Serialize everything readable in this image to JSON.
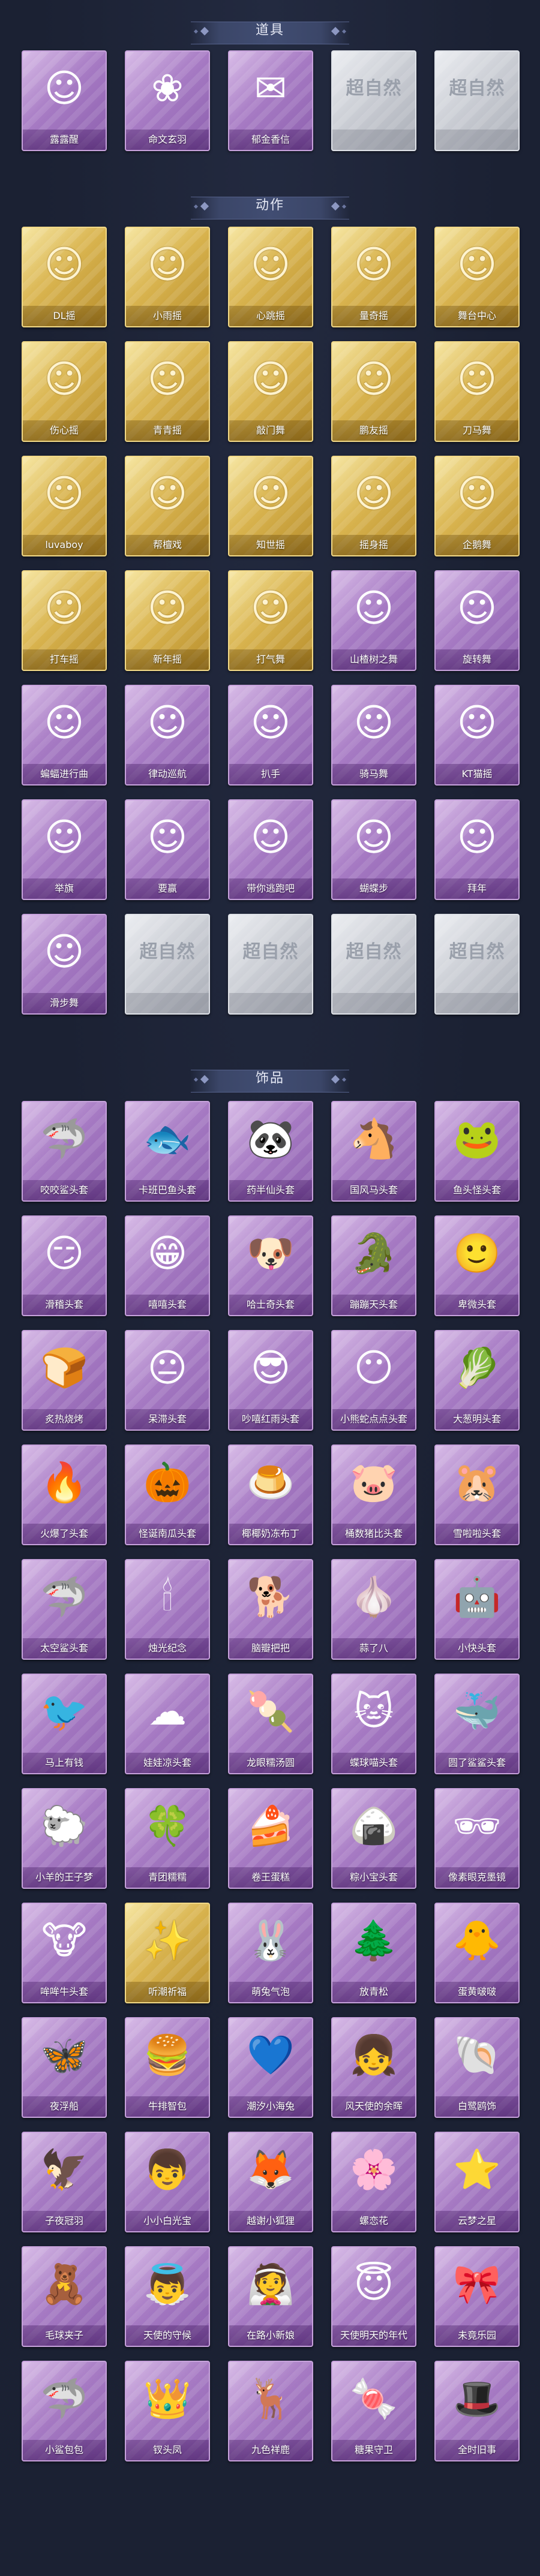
{
  "sections": [
    {
      "title": "道具",
      "items": [
        {
          "label": "露露醒",
          "tier": "purple",
          "icon": "☺"
        },
        {
          "label": "命文玄羽",
          "tier": "purple",
          "icon": "❀"
        },
        {
          "label": "郁金香信",
          "tier": "purple",
          "icon": "✉"
        },
        {
          "label": "",
          "tier": "silver",
          "icon": "超自然"
        },
        {
          "label": "",
          "tier": "silver",
          "icon": "超自然"
        }
      ]
    },
    {
      "title": "动作",
      "items": [
        {
          "label": "DL摇",
          "tier": "gold",
          "icon": "☺"
        },
        {
          "label": "小雨摇",
          "tier": "gold",
          "icon": "☺"
        },
        {
          "label": "心跳摇",
          "tier": "gold",
          "icon": "☺"
        },
        {
          "label": "量奇摇",
          "tier": "gold",
          "icon": "☺"
        },
        {
          "label": "舞台中心",
          "tier": "gold",
          "icon": "☺"
        },
        {
          "label": "伤心摇",
          "tier": "gold",
          "icon": "☺"
        },
        {
          "label": "青青摇",
          "tier": "gold",
          "icon": "☺"
        },
        {
          "label": "敲门舞",
          "tier": "gold",
          "icon": "☺"
        },
        {
          "label": "鹏友摇",
          "tier": "gold",
          "icon": "☺"
        },
        {
          "label": "刀马舞",
          "tier": "gold",
          "icon": "☺"
        },
        {
          "label": "luvaboy",
          "tier": "gold",
          "icon": "☺"
        },
        {
          "label": "帮檀戏",
          "tier": "gold",
          "icon": "☺"
        },
        {
          "label": "知世摇",
          "tier": "gold",
          "icon": "☺"
        },
        {
          "label": "摇身摇",
          "tier": "gold",
          "icon": "☺"
        },
        {
          "label": "企鹅舞",
          "tier": "gold",
          "icon": "☺"
        },
        {
          "label": "打车摇",
          "tier": "gold",
          "icon": "☺"
        },
        {
          "label": "新年摇",
          "tier": "gold",
          "icon": "☺"
        },
        {
          "label": "打气舞",
          "tier": "gold",
          "icon": "☺"
        },
        {
          "label": "山楂树之舞",
          "tier": "purple",
          "icon": "☺"
        },
        {
          "label": "旋转舞",
          "tier": "purple",
          "icon": "☺"
        },
        {
          "label": "蝙蝠进行曲",
          "tier": "purple",
          "icon": "☺"
        },
        {
          "label": "律动巡航",
          "tier": "purple",
          "icon": "☺"
        },
        {
          "label": "扒手",
          "tier": "purple",
          "icon": "☺"
        },
        {
          "label": "骑马舞",
          "tier": "purple",
          "icon": "☺"
        },
        {
          "label": "KT猫摇",
          "tier": "purple",
          "icon": "☺"
        },
        {
          "label": "举旗",
          "tier": "purple",
          "icon": "☺"
        },
        {
          "label": "要赢",
          "tier": "purple",
          "icon": "☺"
        },
        {
          "label": "带你逃跑吧",
          "tier": "purple",
          "icon": "☺"
        },
        {
          "label": "蝴蝶步",
          "tier": "purple",
          "icon": "☺"
        },
        {
          "label": "拜年",
          "tier": "purple",
          "icon": "☺"
        },
        {
          "label": "滑步舞",
          "tier": "purple",
          "icon": "☺"
        },
        {
          "label": "",
          "tier": "silver",
          "icon": "超自然"
        },
        {
          "label": "",
          "tier": "silver",
          "icon": "超自然"
        },
        {
          "label": "",
          "tier": "silver",
          "icon": "超自然"
        },
        {
          "label": "",
          "tier": "silver",
          "icon": "超自然"
        }
      ]
    },
    {
      "title": "饰品",
      "items": [
        {
          "label": "咬咬鲨头套",
          "tier": "purple",
          "icon": "🦈"
        },
        {
          "label": "卡班巴鱼头套",
          "tier": "purple",
          "icon": "🐟"
        },
        {
          "label": "药半仙头套",
          "tier": "purple",
          "icon": "🐼"
        },
        {
          "label": "国风马头套",
          "tier": "purple",
          "icon": "🐴"
        },
        {
          "label": "鱼头怪头套",
          "tier": "purple",
          "icon": "🐸"
        },
        {
          "label": "滑稽头套",
          "tier": "purple",
          "icon": "😏"
        },
        {
          "label": "嘻嘻头套",
          "tier": "purple",
          "icon": "😁"
        },
        {
          "label": "哈士奇头套",
          "tier": "purple",
          "icon": "🐶"
        },
        {
          "label": "蹦蹦天头套",
          "tier": "purple",
          "icon": "🐊"
        },
        {
          "label": "卑微头套",
          "tier": "purple",
          "icon": "🙂"
        },
        {
          "label": "炙热烧烤",
          "tier": "purple",
          "icon": "🍞"
        },
        {
          "label": "呆滞头套",
          "tier": "purple",
          "icon": "😐"
        },
        {
          "label": "吵嘻红雨头套",
          "tier": "purple",
          "icon": "😎"
        },
        {
          "label": "小熊蛇点点头套",
          "tier": "purple",
          "icon": "😶"
        },
        {
          "label": "大葱明头套",
          "tier": "purple",
          "icon": "🥬"
        },
        {
          "label": "火爆了头套",
          "tier": "purple",
          "icon": "🔥"
        },
        {
          "label": "怪诞南瓜头套",
          "tier": "purple",
          "icon": "🎃"
        },
        {
          "label": "椰椰奶冻布丁",
          "tier": "purple",
          "icon": "🍮"
        },
        {
          "label": "桶数猪比头套",
          "tier": "purple",
          "icon": "🐷"
        },
        {
          "label": "雪啦啦头套",
          "tier": "purple",
          "icon": "🐹"
        },
        {
          "label": "太空鲨头套",
          "tier": "purple",
          "icon": "🦈"
        },
        {
          "label": "烛光纪念",
          "tier": "purple",
          "icon": "🕯"
        },
        {
          "label": "脑瓣把把",
          "tier": "purple",
          "icon": "🐕"
        },
        {
          "label": "蒜了八",
          "tier": "purple",
          "icon": "🧄"
        },
        {
          "label": "小快头套",
          "tier": "purple",
          "icon": "🤖"
        },
        {
          "label": "马上有钱",
          "tier": "purple",
          "icon": "🐦"
        },
        {
          "label": "娃娃凉头套",
          "tier": "purple",
          "icon": "☁"
        },
        {
          "label": "龙眼糯汤圆",
          "tier": "purple",
          "icon": "🍡"
        },
        {
          "label": "蝶球喵头套",
          "tier": "purple",
          "icon": "🐱"
        },
        {
          "label": "圆了鲨鲨头套",
          "tier": "purple",
          "icon": "🐳"
        },
        {
          "label": "小羊的王子梦",
          "tier": "purple",
          "icon": "🐑"
        },
        {
          "label": "青团糯糯",
          "tier": "purple",
          "icon": "🍀"
        },
        {
          "label": "卷王蛋糕",
          "tier": "purple",
          "icon": "🍰"
        },
        {
          "label": "粽小宝头套",
          "tier": "purple",
          "icon": "🍙"
        },
        {
          "label": "像素眼克墨镜",
          "tier": "purple",
          "icon": "🕶"
        },
        {
          "label": "哞哞牛头套",
          "tier": "purple",
          "icon": "🐮"
        },
        {
          "label": "听潮祈福",
          "tier": "gold",
          "icon": "✨"
        },
        {
          "label": "萌兔气泡",
          "tier": "purple",
          "icon": "🐰"
        },
        {
          "label": "放青松",
          "tier": "purple",
          "icon": "🌲"
        },
        {
          "label": "蛋黄啵啵",
          "tier": "purple",
          "icon": "🐥"
        },
        {
          "label": "夜浮船",
          "tier": "purple",
          "icon": "🦋"
        },
        {
          "label": "牛排智包",
          "tier": "purple",
          "icon": "🍔"
        },
        {
          "label": "潮汐小海兔",
          "tier": "purple",
          "icon": "💙"
        },
        {
          "label": "风天使的余晖",
          "tier": "purple",
          "icon": "👧"
        },
        {
          "label": "白鹭鸥饰",
          "tier": "purple",
          "icon": "🐚"
        },
        {
          "label": "子夜冠羽",
          "tier": "purple",
          "icon": "🦅"
        },
        {
          "label": "小小白光宝",
          "tier": "purple",
          "icon": "👦"
        },
        {
          "label": "越谢小狐狸",
          "tier": "purple",
          "icon": "🦊"
        },
        {
          "label": "螺恋花",
          "tier": "purple",
          "icon": "🌸"
        },
        {
          "label": "云梦之星",
          "tier": "purple",
          "icon": "⭐"
        },
        {
          "label": "毛球夹子",
          "tier": "purple",
          "icon": "🧸"
        },
        {
          "label": "天使的守候",
          "tier": "purple",
          "icon": "👼"
        },
        {
          "label": "在路小新娘",
          "tier": "purple",
          "icon": "👰"
        },
        {
          "label": "天使明天的年代",
          "tier": "purple",
          "icon": "😇"
        },
        {
          "label": "未竟乐园",
          "tier": "purple",
          "icon": "🎀"
        },
        {
          "label": "小鲨包包",
          "tier": "purple",
          "icon": "🦈"
        },
        {
          "label": "钗头凤",
          "tier": "purple",
          "icon": "👑"
        },
        {
          "label": "九色祥鹿",
          "tier": "purple",
          "icon": "🦌"
        },
        {
          "label": "糖果守卫",
          "tier": "purple",
          "icon": "🍬"
        },
        {
          "label": "全时旧事",
          "tier": "purple",
          "icon": "🎩"
        }
      ]
    }
  ]
}
